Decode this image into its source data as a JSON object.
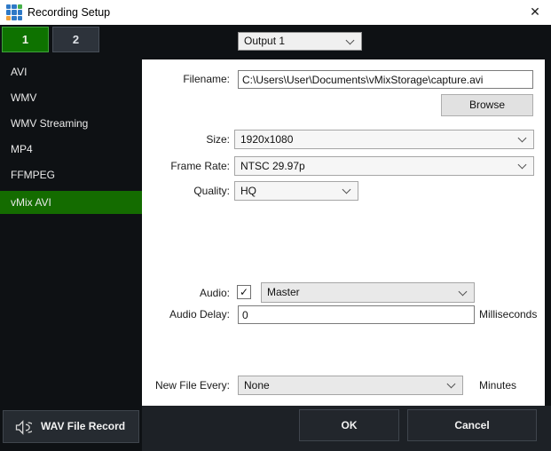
{
  "window": {
    "title": "Recording Setup",
    "close_glyph": "✕"
  },
  "tabs": [
    {
      "label": "1",
      "selected": true
    },
    {
      "label": "2",
      "selected": false
    }
  ],
  "output_select": {
    "value": "Output 1"
  },
  "sidebar": {
    "items": [
      {
        "label": "AVI"
      },
      {
        "label": "WMV"
      },
      {
        "label": "WMV Streaming"
      },
      {
        "label": "MP4"
      },
      {
        "label": "FFMPEG"
      },
      {
        "label": "vMix AVI",
        "selected": true
      }
    ]
  },
  "form": {
    "filename": {
      "label": "Filename:",
      "value": "C:\\Users\\User\\Documents\\vMixStorage\\capture.avi"
    },
    "browse_label": "Browse",
    "size": {
      "label": "Size:",
      "value": "1920x1080"
    },
    "frame_rate": {
      "label": "Frame Rate:",
      "value": "NTSC 29.97p"
    },
    "quality": {
      "label": "Quality:",
      "value": "HQ"
    },
    "audio": {
      "label": "Audio:",
      "checked": true,
      "checkbox_glyph": "✓",
      "value": "Master"
    },
    "audio_delay": {
      "label": "Audio Delay:",
      "value": "0",
      "suffix": "Milliseconds"
    },
    "new_file_every": {
      "label": "New File Every:",
      "value": "None",
      "suffix": "Minutes"
    }
  },
  "footer": {
    "wav_button": "WAV File Record",
    "ok": "OK",
    "cancel": "Cancel"
  },
  "colors": {
    "accent_green": "#146c00",
    "tab_green": "#0e7200",
    "tab_green_border": "#3fa23b",
    "dark_bg": "#0e1114",
    "bottom_bar": "#1d2126",
    "logo_blue": "#2e79c7",
    "logo_green": "#46b049",
    "logo_orange": "#f2a33c"
  }
}
